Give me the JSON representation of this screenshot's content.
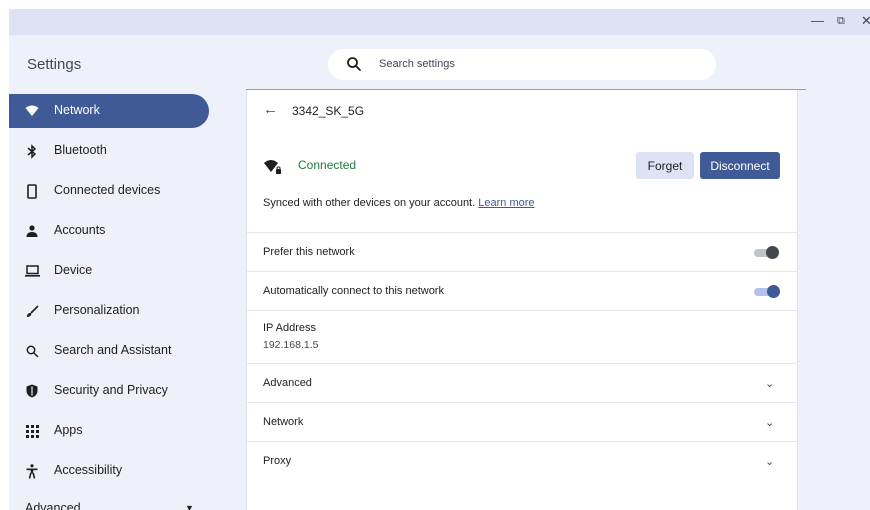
{
  "window": {
    "minimize_icon": "minimize-icon",
    "maximize_icon": "restore-icon",
    "close_icon": "close-icon"
  },
  "header": {
    "title": "Settings",
    "search": {
      "placeholder": "Search settings"
    }
  },
  "sidebar": {
    "items": [
      {
        "label": "Network",
        "icon": "wifi-icon",
        "active": true
      },
      {
        "label": "Bluetooth",
        "icon": "bluetooth-icon"
      },
      {
        "label": "Connected devices",
        "icon": "phone-icon"
      },
      {
        "label": "Accounts",
        "icon": "person-icon"
      },
      {
        "label": "Device",
        "icon": "laptop-icon"
      },
      {
        "label": "Personalization",
        "icon": "brush-icon"
      },
      {
        "label": "Search and Assistant",
        "icon": "search-icon"
      },
      {
        "label": "Security and Privacy",
        "icon": "shield-icon"
      },
      {
        "label": "Apps",
        "icon": "grid-icon"
      },
      {
        "label": "Accessibility",
        "icon": "accessibility-icon"
      }
    ],
    "advanced_label": "Advanced"
  },
  "main": {
    "network_name": "3342_SK_5G",
    "status": "Connected",
    "forget_label": "Forget",
    "disconnect_label": "Disconnect",
    "synced_text": "Synced with other devices on your account.",
    "learn_more": "Learn more",
    "prefer_label": "Prefer this network",
    "prefer_on": false,
    "autoconnect_label": "Automatically connect to this network",
    "autoconnect_on": true,
    "ip_label": "IP Address",
    "ip_value": "192.168.1.5",
    "sections": [
      "Advanced",
      "Network",
      "Proxy"
    ]
  },
  "colors": {
    "accent": "#3f5a96",
    "connected_green": "#1e7a3c",
    "background": "#eef1f9"
  }
}
